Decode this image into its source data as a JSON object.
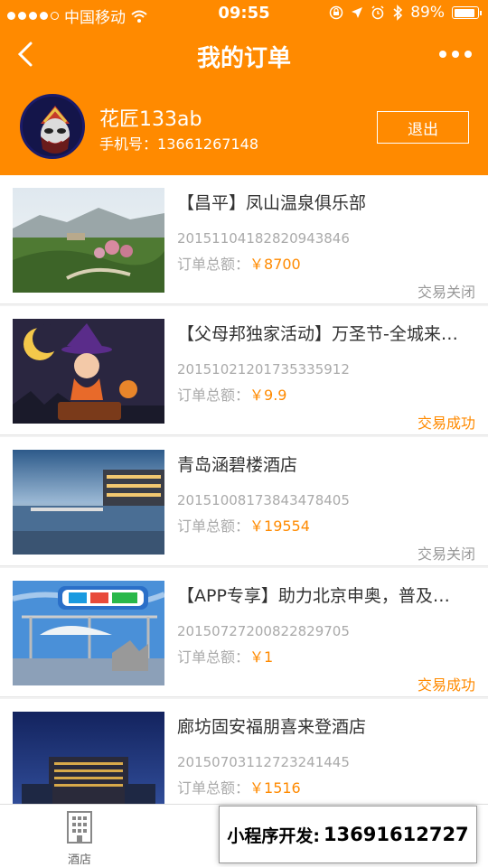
{
  "status_bar": {
    "carrier": "中国移动",
    "time": "09:55",
    "battery": "89%",
    "battery_level": 0.89
  },
  "nav": {
    "title": "我的订单"
  },
  "profile": {
    "name": "花匠133ab",
    "phone_label": "手机号：",
    "phone": "13661267148",
    "logout_label": "退出"
  },
  "orders": [
    {
      "title": "【昌平】凤山温泉俱乐部",
      "order_no": "2015110418282094384​6",
      "total_label": "订单总额：",
      "amount": "￥8700",
      "status": "交易关闭",
      "status_type": "closed"
    },
    {
      "title": "【父母邦独家活动】万圣节-全城来…",
      "order_no": "2015102120173533591​2",
      "total_label": "订单总额：",
      "amount": "￥9.9",
      "status": "交易成功",
      "status_type": "success"
    },
    {
      "title": "青岛涵碧楼酒店",
      "order_no": "20151008173843478405",
      "total_label": "订单总额：",
      "amount": "￥19554",
      "status": "交易关闭",
      "status_type": "closed"
    },
    {
      "title": "【APP专享】助力北京申奥，普及…",
      "order_no": "20150727200822829705",
      "total_label": "订单总额：",
      "amount": "￥1",
      "status": "交易成功",
      "status_type": "success"
    },
    {
      "title": "廊坊固安福朋喜来登酒店",
      "order_no": "20150703112723241445",
      "total_label": "订单总额：",
      "amount": "￥1516",
      "status": "",
      "status_type": "none"
    }
  ],
  "tabbar": {
    "hotel_label": "酒店"
  },
  "promo": {
    "label": "小程序开发:",
    "phone": "13691612727"
  },
  "colors": {
    "accent": "#ff8a00",
    "muted": "#aaaaaa"
  }
}
